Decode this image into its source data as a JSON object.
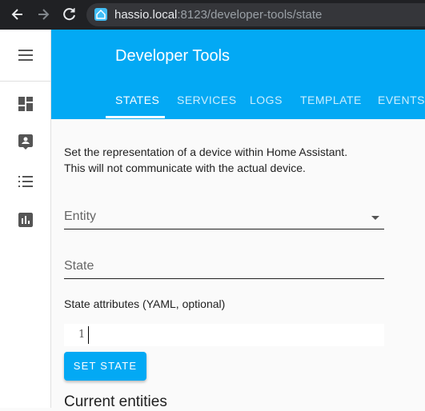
{
  "browser": {
    "url_host": "hassio.local",
    "url_path": ":8123/developer-tools/state"
  },
  "sidebar": {
    "items": [
      {
        "icon": "menu-icon"
      },
      {
        "icon": "dashboard-icon"
      },
      {
        "icon": "map-marker-icon"
      },
      {
        "icon": "logbook-list-icon"
      },
      {
        "icon": "history-chart-icon"
      }
    ]
  },
  "header": {
    "title": "Developer Tools",
    "tabs": [
      "STATES",
      "SERVICES",
      "LOGS",
      "TEMPLATE",
      "EVENTS"
    ],
    "active_tab": "STATES"
  },
  "main": {
    "description_line1": "Set the representation of a device within Home Assistant.",
    "description_line2": "This will not communicate with the actual device.",
    "entity_label": "Entity",
    "state_label": "State",
    "attributes_label": "State attributes (YAML, optional)",
    "editor_line_number": "1",
    "set_state_button": "SET STATE",
    "current_entities_heading": "Current entities"
  },
  "colors": {
    "accent": "#03a9f4",
    "browser_bar": "#202124"
  }
}
